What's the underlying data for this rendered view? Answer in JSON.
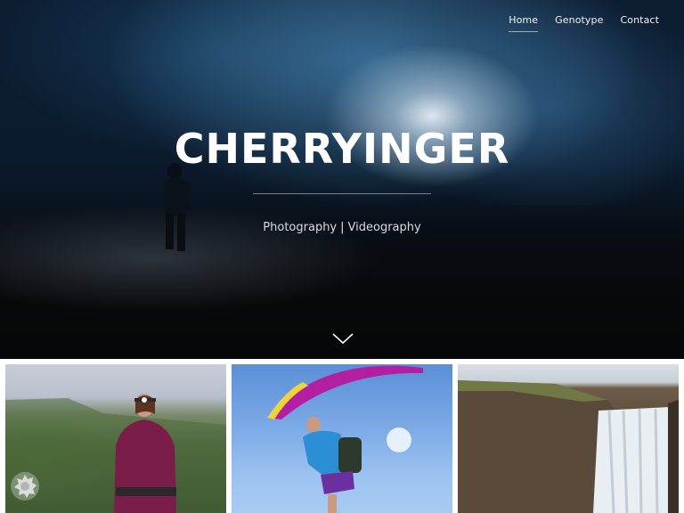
{
  "nav": {
    "items": [
      {
        "label": "Home",
        "active": true
      },
      {
        "label": "Genotype",
        "active": false
      },
      {
        "label": "Contact",
        "active": false
      }
    ]
  },
  "hero": {
    "title": "CHERRYINGER",
    "tagline_left": "Photography",
    "tagline_sep": "|",
    "tagline_right": "Videography"
  },
  "icons": {
    "scroll": "chevron-down-icon",
    "cookie": "cookie-settings-icon"
  },
  "colors": {
    "accent": "#ffffff",
    "hero_dark": "#0b1a2c"
  }
}
